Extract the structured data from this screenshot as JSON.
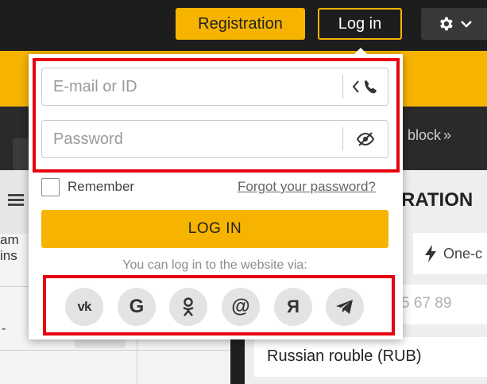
{
  "header": {
    "registration_label": "Registration",
    "login_label": "Log in",
    "settings_icon": "gear-icon",
    "chevron_icon": "chevron-down-icon"
  },
  "nav": {
    "block_link_label": "block",
    "block_link_arrow": "»"
  },
  "sidebar": {
    "team_wins_label_1": "am",
    "team_wins_label_2": "ins"
  },
  "registration_panel": {
    "title": "RATION",
    "one_click_tab_label": "One-c",
    "phone_placeholder": "5 67 89",
    "currency_value": "Russian rouble (RUB)"
  },
  "login_popup": {
    "email_placeholder": "E-mail or ID",
    "password_placeholder": "Password",
    "phone_toggle_icon": "phone-switch-icon",
    "eye_icon": "eye-hidden-icon",
    "remember_label": "Remember",
    "forgot_label": "Forgot your password?",
    "login_button_label": "LOG IN",
    "social_caption": "You can log in to the website via:",
    "social_buttons": [
      {
        "name": "vk",
        "text": "vk"
      },
      {
        "name": "google",
        "text": "G"
      },
      {
        "name": "odnoklassniki",
        "text": ""
      },
      {
        "name": "mailru",
        "text": "@"
      },
      {
        "name": "yandex",
        "text": "Я"
      },
      {
        "name": "telegram",
        "text": ""
      }
    ]
  },
  "colors": {
    "brand_yellow": "#f6b400",
    "dark_bg": "#1d1d1d",
    "highlight_red": "#e8000e"
  }
}
